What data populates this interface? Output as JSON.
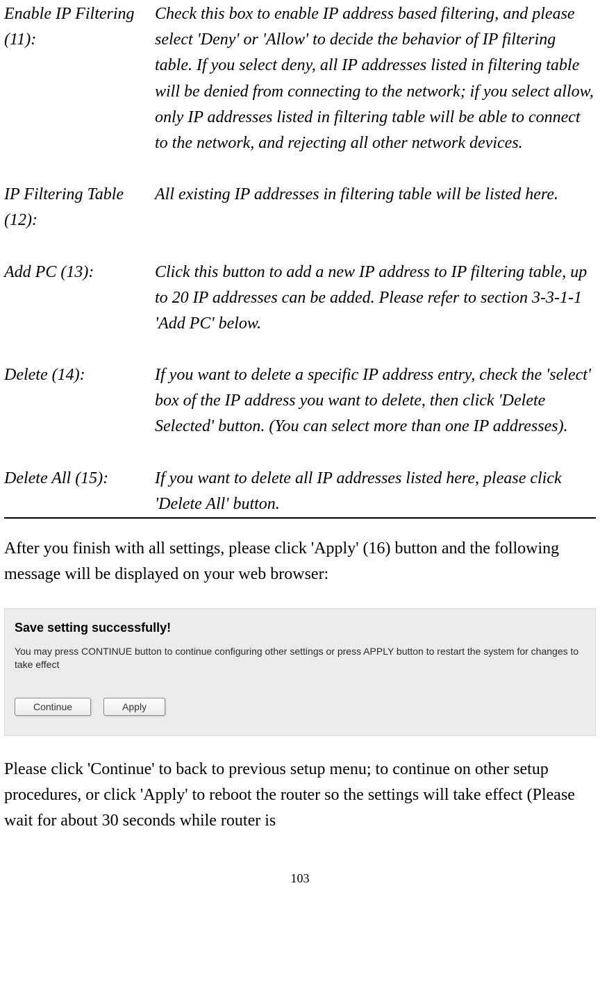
{
  "definitions": [
    {
      "term": "Enable IP Filtering (11):",
      "desc": "Check this box to enable IP address based filtering, and please select 'Deny' or 'Allow' to decide the behavior of IP filtering table. If you select deny, all IP addresses listed in filtering table will be denied from connecting to the network; if you select allow, only IP addresses listed in filtering table will be able to connect to the network, and rejecting all other network devices."
    },
    {
      "term": "IP Filtering Table (12):",
      "desc": "All existing IP addresses in filtering table will be listed here."
    },
    {
      "term": "Add PC (13):",
      "desc": "Click this button to add a new IP address to IP filtering table, up to 20 IP addresses can be added. Please refer to section 3-3-1-1 'Add PC' below."
    },
    {
      "term": "Delete (14):",
      "desc": "If you want to delete a specific IP address entry, check the 'select' box of the IP address you want to delete, then click 'Delete Selected' button. (You can select more than one IP addresses)."
    },
    {
      "term": "Delete All (15):",
      "desc": "If you want to delete all IP addresses listed here, please click 'Delete All' button."
    }
  ],
  "after_text": "After you finish with all settings, please click 'Apply' (16) button and the following message will be displayed on your web browser:",
  "dialog": {
    "title": "Save setting successfully!",
    "message": "You may press CONTINUE button to continue configuring other settings or press APPLY button to restart the system for changes to take effect",
    "continue_label": "Continue",
    "apply_label": "Apply"
  },
  "continue_text": "Please click 'Continue' to back to previous setup menu; to continue on other setup procedures, or click 'Apply' to reboot the router so the settings will take effect (Please wait for about 30 seconds while router is",
  "page_number": "103"
}
